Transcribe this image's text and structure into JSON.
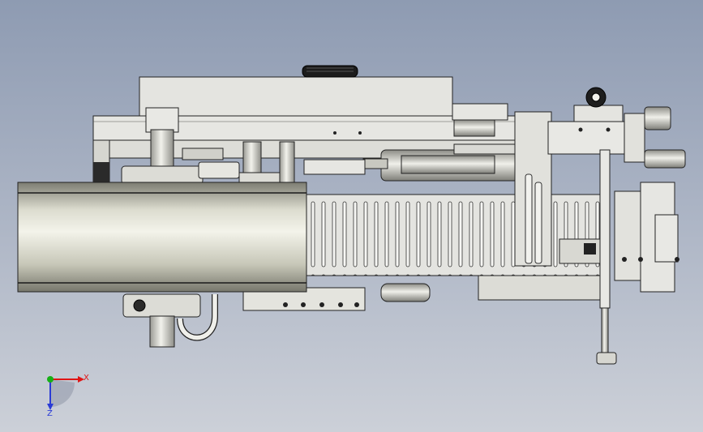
{
  "app": {
    "kind": "cad-viewport"
  },
  "colors": {
    "background_top": "#8e9bb2",
    "background_bottom": "#ccd0d8",
    "part_fill": "#e3e3df",
    "part_shade": "#c9c9c2",
    "part_stroke": "#2a2a2a",
    "x_axis": "#e01515",
    "y_axis": "#16b016",
    "z_axis": "#2a3bd6"
  },
  "triad": {
    "x_label": "X",
    "z_label": "Z",
    "icons": [
      "x-axis-arrow-icon",
      "y-axis-dot-icon",
      "z-axis-arrow-icon"
    ]
  }
}
